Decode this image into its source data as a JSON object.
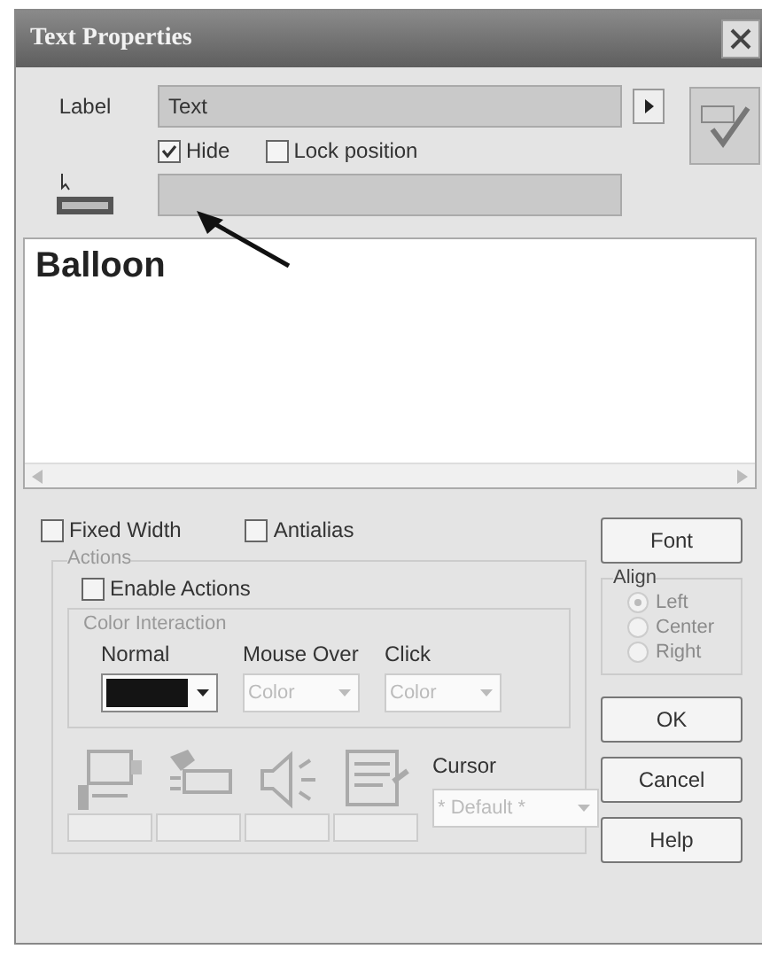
{
  "window": {
    "title": "Text Properties"
  },
  "label_row": {
    "label": "Label",
    "value": "Text"
  },
  "options": [
    {
      "label": "Hide",
      "checked": true
    },
    {
      "label": "Lock position",
      "checked": false
    }
  ],
  "text_area": {
    "value": "Balloon"
  },
  "style_options": [
    {
      "label": "Fixed Width",
      "checked": false
    },
    {
      "label": "Antialias",
      "checked": false
    }
  ],
  "actions": {
    "title": "Actions",
    "enable": {
      "label": "Enable Actions",
      "checked": false
    },
    "color_interaction": {
      "title": "Color Interaction",
      "columns": [
        {
          "heading": "Normal",
          "color": "#141414",
          "disabled": false
        },
        {
          "heading": "Mouse Over",
          "value": "Color",
          "disabled": true
        },
        {
          "heading": "Click",
          "value": "Color",
          "disabled": true
        }
      ]
    },
    "cursor": {
      "label": "Cursor",
      "value": "* Default *",
      "disabled": true
    }
  },
  "font_button": "Font",
  "align": {
    "title": "Align",
    "disabled": true,
    "options": [
      {
        "label": "Left",
        "selected": true
      },
      {
        "label": "Center",
        "selected": false
      },
      {
        "label": "Right",
        "selected": false
      }
    ]
  },
  "buttons": [
    "OK",
    "Cancel",
    "Help"
  ]
}
